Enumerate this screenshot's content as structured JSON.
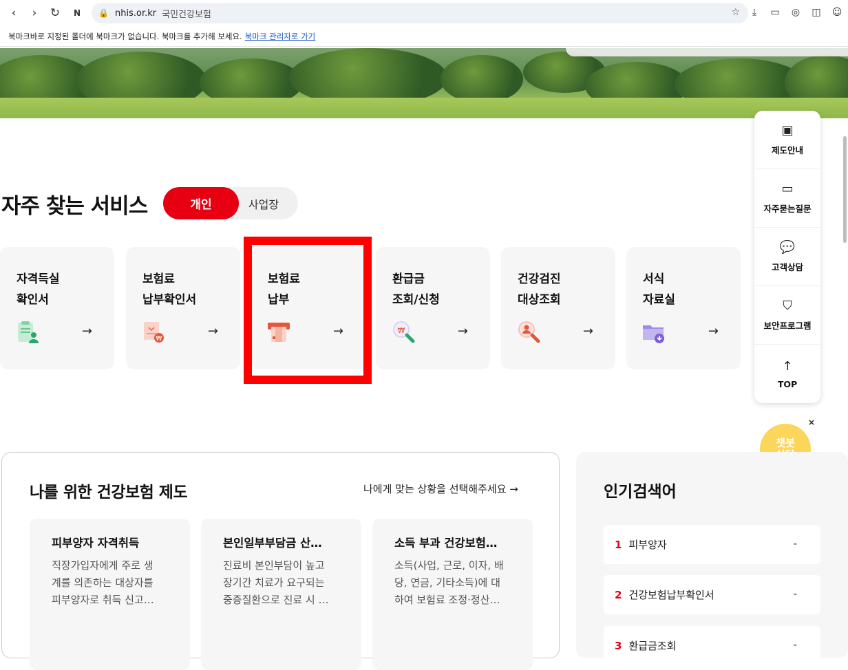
{
  "browser": {
    "url_domain": "nhis.or.kr",
    "page_title": "국민건강보험",
    "bookmark_message": "북마크바로 지정된 폴더에 북마크가 없습니다. 북마크를 추가해 보세요.",
    "bookmark_link": "북마크 관리자로 가기"
  },
  "services": {
    "title": "자주 찾는 서비스",
    "toggle_on": "개인",
    "toggle_off": "사업장",
    "cards": [
      {
        "line1": "자격득실",
        "line2": "확인서",
        "icon": "clipboard-person-icon"
      },
      {
        "line1": "보험료",
        "line2": "납부확인서",
        "icon": "receipt-won-icon"
      },
      {
        "line1": "보험료",
        "line2": "납부",
        "icon": "card-payment-icon"
      },
      {
        "line1": "환급금",
        "line2": "조회/신청",
        "icon": "magnifier-won-icon"
      },
      {
        "line1": "건강검진",
        "line2": "대상조회",
        "icon": "magnifier-person-icon"
      },
      {
        "line1": "서식",
        "line2": "자료실",
        "icon": "folder-download-icon"
      }
    ],
    "arrow": "→"
  },
  "side_menu": [
    {
      "label": "제도안내",
      "icon": "book-icon"
    },
    {
      "label": "자주묻는질문",
      "icon": "folder-question-icon"
    },
    {
      "label": "고객상담",
      "icon": "chat-bubble-icon"
    },
    {
      "label": "보안프로그램",
      "icon": "shield-icon"
    },
    {
      "label": "TOP",
      "icon": "arrow-up-icon"
    }
  ],
  "chatbot": {
    "line1": "챗봇",
    "line2": "상담",
    "close": "×"
  },
  "insurance": {
    "title": "나를 위한 건강보험 제도",
    "link": "나에게 맞는 상황을 선택해주세요 →",
    "cards": [
      {
        "title": "피부양자 자격취득",
        "lines": [
          "직장가입자에게 주로 생",
          "계를 의존하는 대상자를",
          "피부양자로 취득 신고…"
        ]
      },
      {
        "title": "본인일부부담금 산…",
        "lines": [
          "진료비 본인부담이 높고",
          "장기간 치료가 요구되는",
          "중증질환으로 진료 시 …"
        ]
      },
      {
        "title": "소득 부과 건강보험…",
        "lines": [
          "소득(사업, 근로, 이자, 배",
          "당, 연금, 기타소득)에 대",
          "하여 보험료 조정·정산…"
        ]
      }
    ]
  },
  "popular": {
    "title": "인기검색어",
    "items": [
      {
        "rank": "1",
        "term": "피부양자",
        "change": "-"
      },
      {
        "rank": "2",
        "term": "건강보험납부확인서",
        "change": "-"
      },
      {
        "rank": "3",
        "term": "환급금조회",
        "change": "-"
      }
    ]
  }
}
